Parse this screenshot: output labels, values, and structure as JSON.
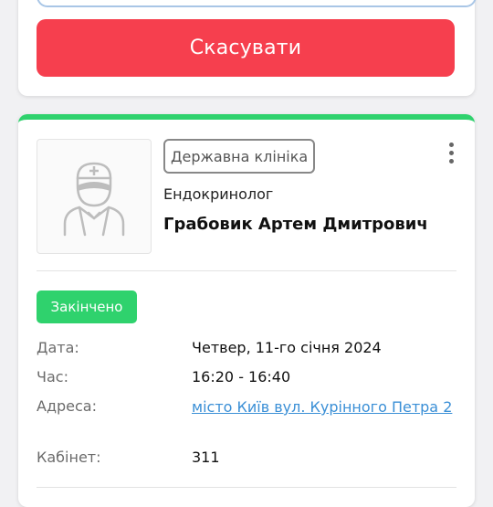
{
  "top_card": {
    "cancel_label": "Скасувати"
  },
  "appointment": {
    "clinic_type": "Державна клініка",
    "specialty": "Ендокринолог",
    "doctor_name": "Грабовик Артем Дмитрович",
    "status": "Закінчено",
    "status_color": "#2fd26d",
    "details": {
      "date_label": "Дата:",
      "date_value": "Четвер, 11-го січня 2024",
      "time_label": "Час:",
      "time_value": "16:20 - 16:40",
      "address_label": "Адреса:",
      "address_value": "місто Київ вул. Курінного Петра 2",
      "room_label": "Кабінет:",
      "room_value": "311"
    }
  },
  "colors": {
    "accent_cancel": "#f63f4e",
    "link": "#3a8fd6"
  },
  "icons": {
    "avatar": "doctor-avatar-icon",
    "menu": "more-vertical-icon"
  }
}
